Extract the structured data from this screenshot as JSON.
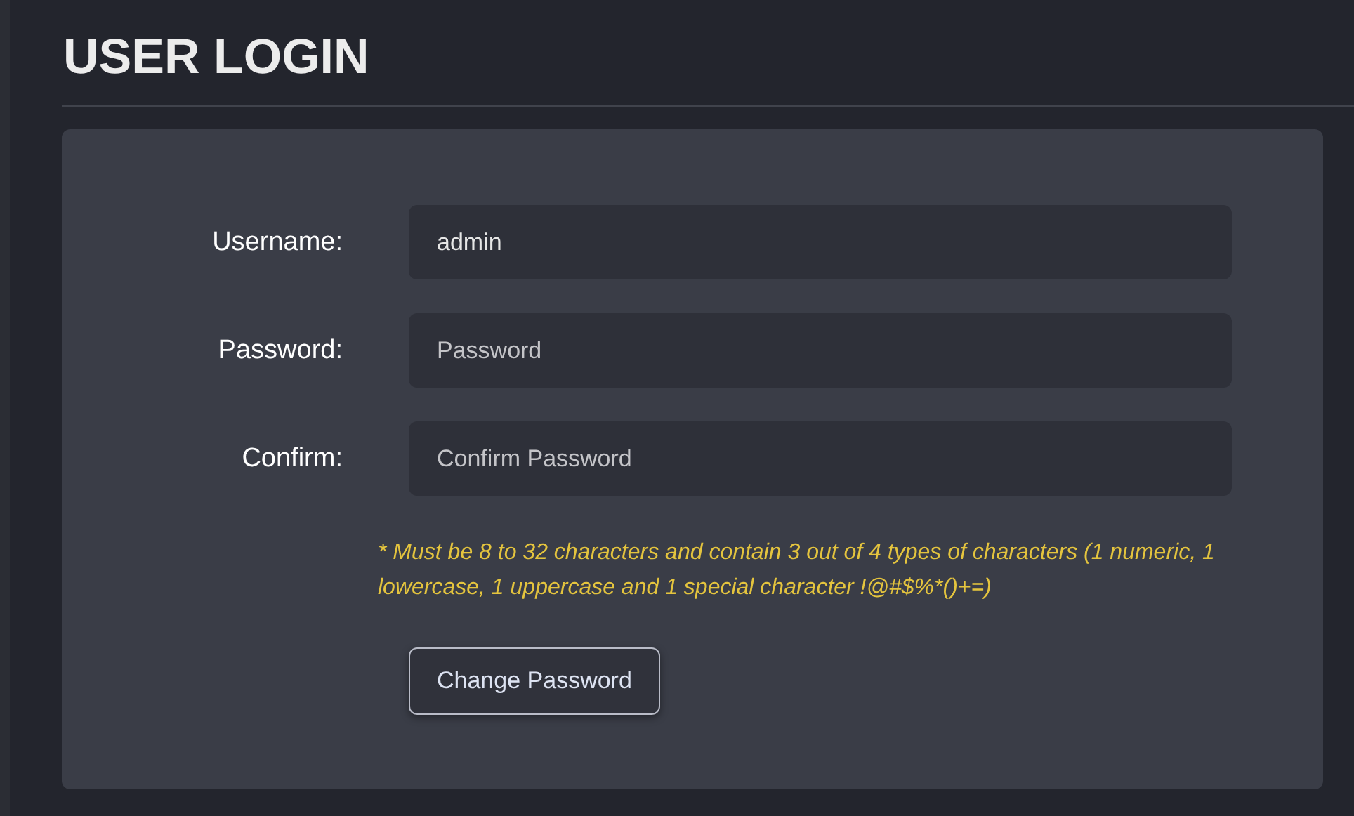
{
  "title": "USER LOGIN",
  "fields": [
    {
      "label": "Username:",
      "value": "admin"
    },
    {
      "label": "Password:",
      "placeholder": "Password"
    },
    {
      "label": "Confirm:",
      "placeholder": "Confirm Password"
    }
  ],
  "hint": "* Must be 8 to 32 characters and contain 3 out of 4 types of characters (1 numeric, 1 lowercase, 1 uppercase and 1 special character !@#$%*()+=)",
  "button": "Change Password"
}
